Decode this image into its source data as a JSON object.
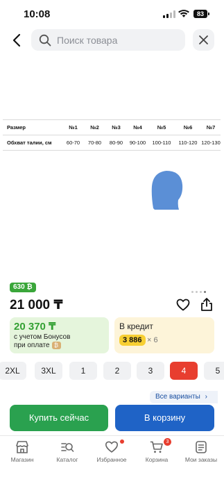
{
  "status_bar": {
    "time": "10:08",
    "battery": "83"
  },
  "search": {
    "placeholder": "Поиск товара"
  },
  "size_table": {
    "header": [
      "Размер",
      "№1",
      "№2",
      "№3",
      "№4",
      "№5",
      "№6",
      "№7"
    ],
    "row": [
      "Обхват талии, см",
      "60-70",
      "70-80",
      "80-90",
      "90-100",
      "100-110",
      "110-120",
      "120-130"
    ]
  },
  "product": {
    "badge": "630 ₿",
    "price": "21 000 ₸",
    "bonus": {
      "value": "20 370 ₸",
      "line1": "с учетом Бонусов",
      "line2": "при оплате"
    },
    "credit": {
      "title": "В кредит",
      "amount": "3 886",
      "multiplier": "× 6"
    }
  },
  "sizes": [
    "2XL",
    "3XL",
    "1",
    "2",
    "3",
    "4",
    "5"
  ],
  "selected_size": "4",
  "all_variants": "Все варианты",
  "buttons": {
    "buy_now": "Купить сейчас",
    "to_cart": "В корзину"
  },
  "tabbar": {
    "items": [
      {
        "label": "Магазин",
        "icon": "shop-icon"
      },
      {
        "label": "Каталог",
        "icon": "catalog-icon"
      },
      {
        "label": "Избранное",
        "icon": "heart-icon"
      },
      {
        "label": "Корзина",
        "icon": "cart-icon"
      },
      {
        "label": "Мои заказы",
        "icon": "orders-icon"
      }
    ],
    "cart_count": "3"
  },
  "colors": {
    "accent_blue": "#1f63c6",
    "green": "#2aa14f",
    "selected_red": "#e83e2f"
  }
}
